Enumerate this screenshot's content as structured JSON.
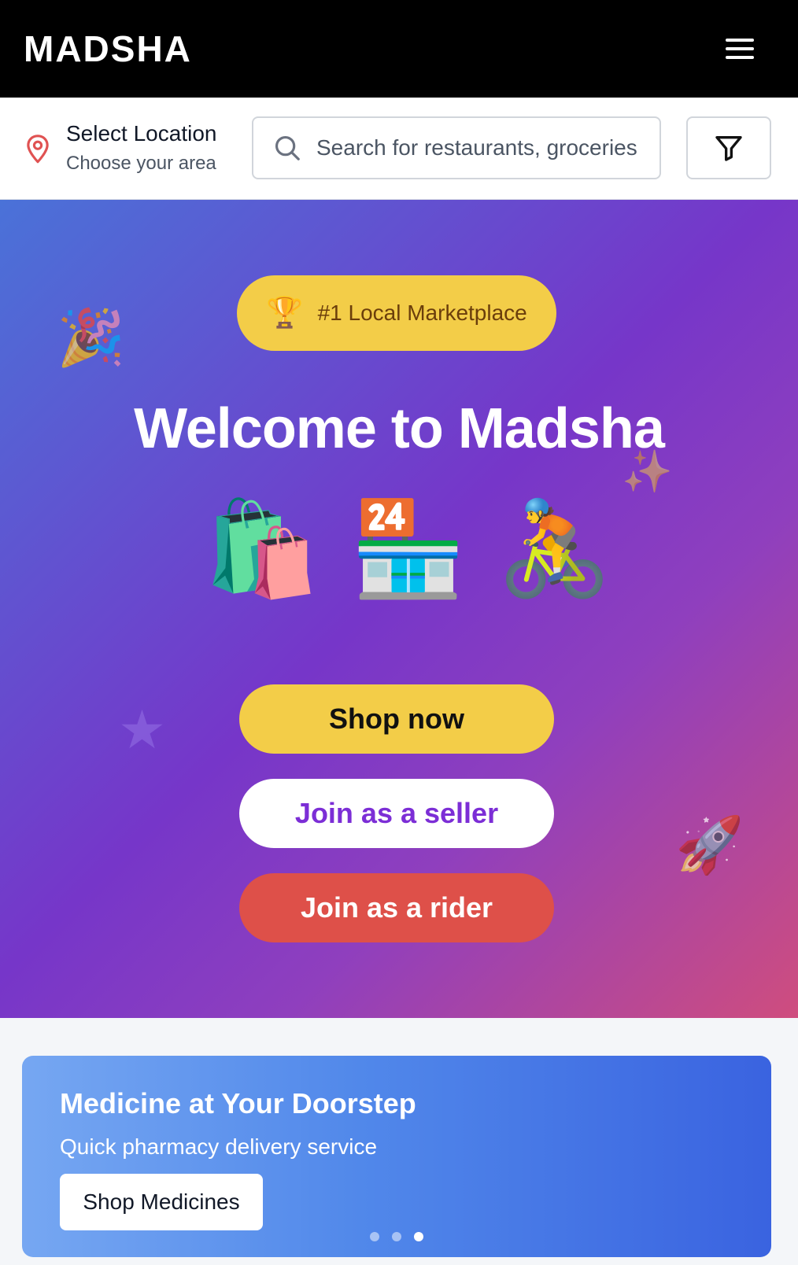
{
  "header": {
    "brand": "MADSHA",
    "menu_icon": "hamburger-menu-icon"
  },
  "location": {
    "icon": "map-pin-icon",
    "title": "Select Location",
    "subtitle": "Choose your area"
  },
  "search": {
    "icon": "search-icon",
    "placeholder": "Search for restaurants, groceries",
    "value": ""
  },
  "filter": {
    "icon": "filter-funnel-icon"
  },
  "hero": {
    "badge_icon": "🏆",
    "badge_text": "#1 Local Marketplace",
    "title": "Welcome to Madsha",
    "emojis": [
      "🛍️",
      "🏪",
      "🚴"
    ],
    "decorations": [
      "🎉",
      "✨",
      "★",
      "🚀"
    ],
    "buttons": {
      "shop": "Shop now",
      "seller": "Join as a seller",
      "rider": "Join as a rider"
    }
  },
  "promo": {
    "title": "Medicine at Your Doorstep",
    "subtitle": "Quick pharmacy delivery service",
    "button": "Shop Medicines",
    "carousel": {
      "count": 3,
      "active_index": 3
    }
  },
  "colors": {
    "header_bg": "#000000",
    "accent_yellow": "#f3cd48",
    "accent_purple": "#7c2ed6",
    "accent_red": "#de5049",
    "promo_blue": "#3a63e0"
  }
}
